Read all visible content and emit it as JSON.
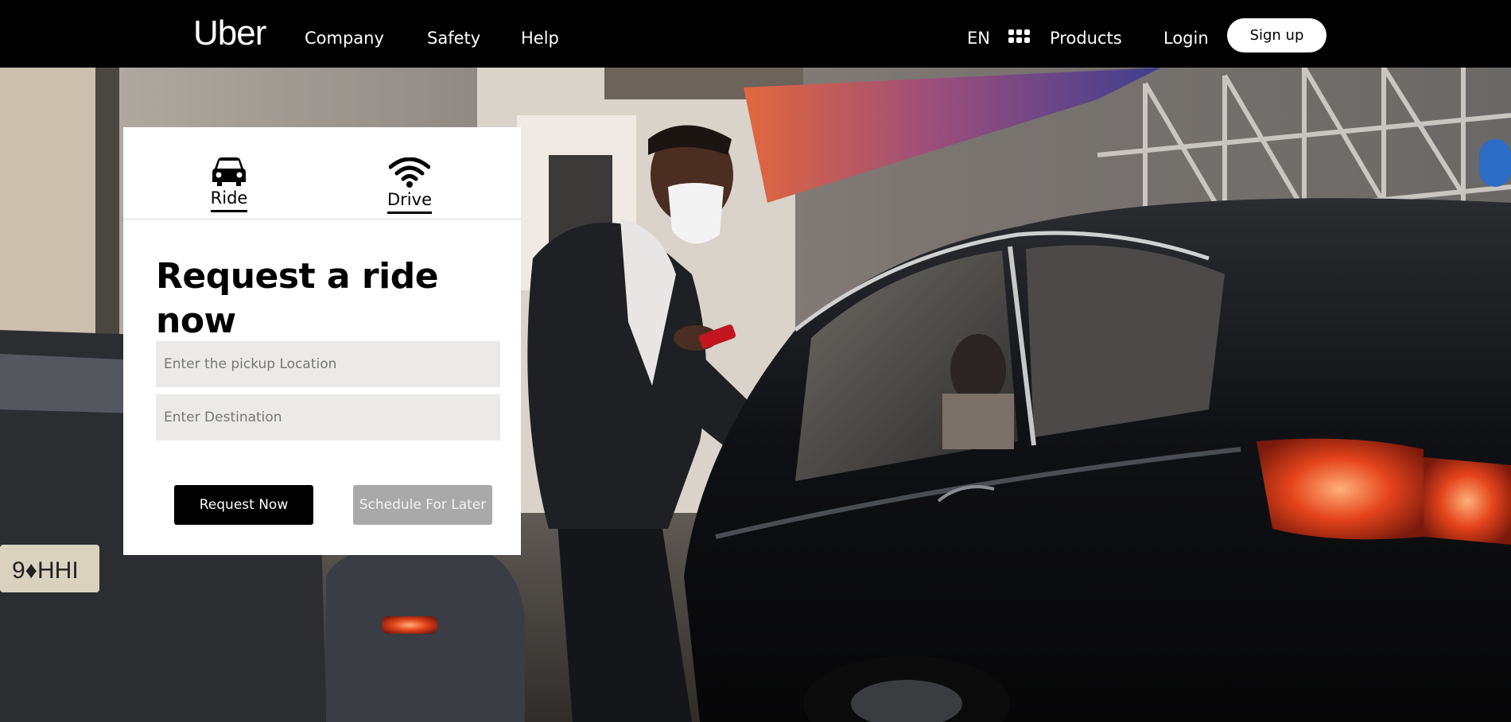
{
  "nav": {
    "logo": "Uber",
    "links": [
      "Company",
      "Safety",
      "Help"
    ],
    "language": "EN",
    "products": "Products",
    "login": "Login",
    "signup": "Sign up"
  },
  "card": {
    "tabs": [
      {
        "label": "Ride",
        "icon": "car-icon"
      },
      {
        "label": "Drive",
        "icon": "wifi-icon"
      }
    ],
    "title": "Request a ride now",
    "pickup_placeholder": "Enter the pickup Location",
    "destination_placeholder": "Enter Destination",
    "request_label": "Request Now",
    "schedule_label": "Schedule For Later"
  },
  "colors": {
    "nav_bg": "#000000",
    "button_primary": "#000000",
    "button_disabled": "#a9a9a9",
    "input_bg": "#ebeae9"
  }
}
